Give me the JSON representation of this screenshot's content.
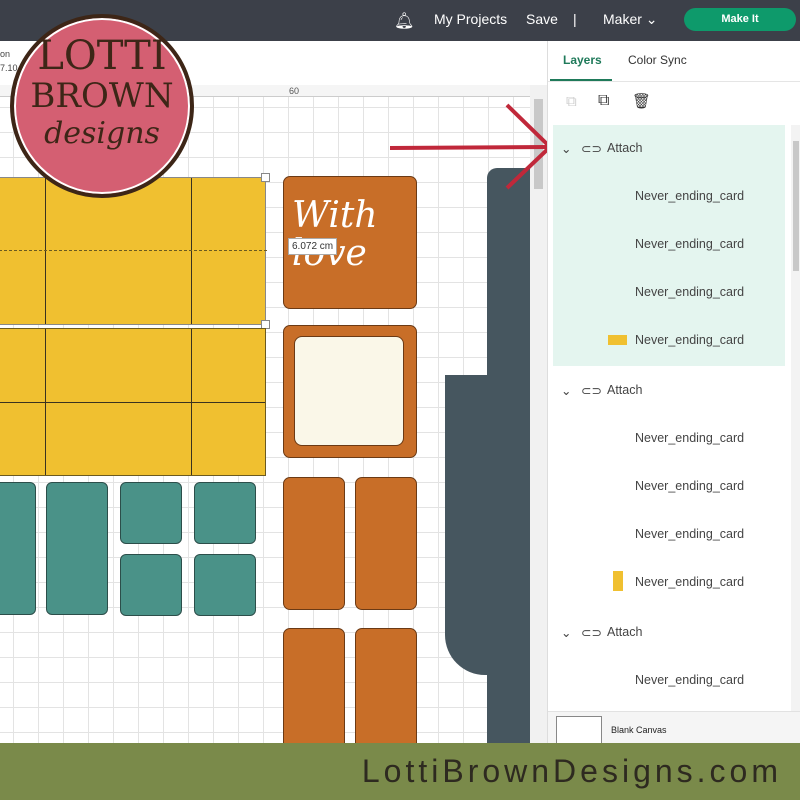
{
  "topbar": {
    "notifications_icon": "bell-icon",
    "my_projects": "My Projects",
    "save": "Save",
    "separator": "|",
    "machine": "Maker",
    "make_it": "Make It"
  },
  "canvas": {
    "partial_label_1": "on",
    "partial_label_2": "7.10",
    "ruler_label": "60",
    "dimension_tooltip": "6.072 cm",
    "card_text": "With love"
  },
  "panel": {
    "tabs": [
      {
        "label": "Layers",
        "active": true
      },
      {
        "label": "Color Sync",
        "active": false
      }
    ],
    "toolbar": [
      "ungroup-icon",
      "duplicate-icon",
      "delete-icon"
    ],
    "groups": [
      {
        "label": "Attach",
        "items": [
          "Never_ending_card",
          "Never_ending_card",
          "Never_ending_card",
          "Never_ending_card"
        ],
        "swatches": [
          "",
          "",
          "",
          "#f0c030"
        ],
        "selected": true
      },
      {
        "label": "Attach",
        "items": [
          "Never_ending_card",
          "Never_ending_card",
          "Never_ending_card",
          "Never_ending_card"
        ],
        "swatches": [
          "",
          "",
          "",
          "#f0c030"
        ],
        "selected": false
      },
      {
        "label": "Attach",
        "items": [
          "Never_ending_card"
        ],
        "swatches": [
          ""
        ],
        "selected": false
      }
    ],
    "blank_canvas": "Blank Canvas"
  },
  "logo": {
    "line1": "LOTTI",
    "line2": "BROWN",
    "line3": "designs"
  },
  "banner": {
    "text": "LottiBrownDesigns.com"
  },
  "colors": {
    "accent": "#0e9a6b",
    "yellow": "#f0c030",
    "orange": "#c86e28",
    "teal": "#4a9288",
    "slate": "#46565f",
    "banner": "#7a8a4a",
    "arrow": "#c0283a"
  }
}
